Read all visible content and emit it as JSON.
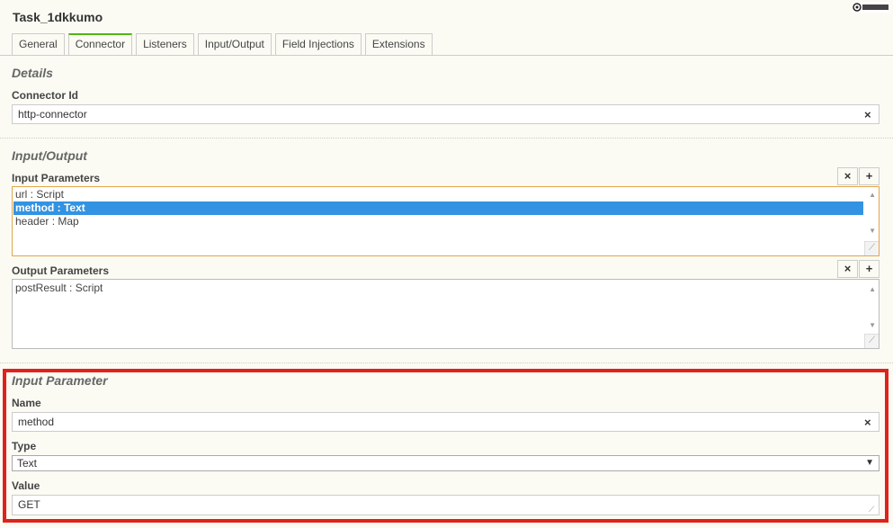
{
  "window": {
    "title": "Task_1dkkumo"
  },
  "tabs": [
    {
      "label": "General",
      "active": false
    },
    {
      "label": "Connector",
      "active": true
    },
    {
      "label": "Listeners",
      "active": false
    },
    {
      "label": "Input/Output",
      "active": false
    },
    {
      "label": "Field Injections",
      "active": false
    },
    {
      "label": "Extensions",
      "active": false
    }
  ],
  "details": {
    "heading": "Details",
    "connector_id_label": "Connector Id",
    "connector_id_value": "http-connector",
    "clear_icon": "×"
  },
  "io": {
    "heading": "Input/Output",
    "input_label": "Input Parameters",
    "input_items": [
      {
        "text": "url : Script",
        "selected": false
      },
      {
        "text": "method : Text",
        "selected": true
      },
      {
        "text": "header : Map",
        "selected": false
      }
    ],
    "output_label": "Output Parameters",
    "output_items": [
      {
        "text": "postResult : Script",
        "selected": false
      }
    ],
    "remove_icon": "×",
    "add_icon": "+"
  },
  "input_parameter": {
    "heading": "Input Parameter",
    "name_label": "Name",
    "name_value": "method",
    "type_label": "Type",
    "type_value": "Text",
    "value_label": "Value",
    "value_value": "GET",
    "clear_icon": "×",
    "caret_icon": "▼"
  },
  "colors": {
    "highlight_border": "#e0221c",
    "selected_row": "#3393e2",
    "active_tab_accent": "#52b415",
    "focus_border": "#e2a54b"
  }
}
